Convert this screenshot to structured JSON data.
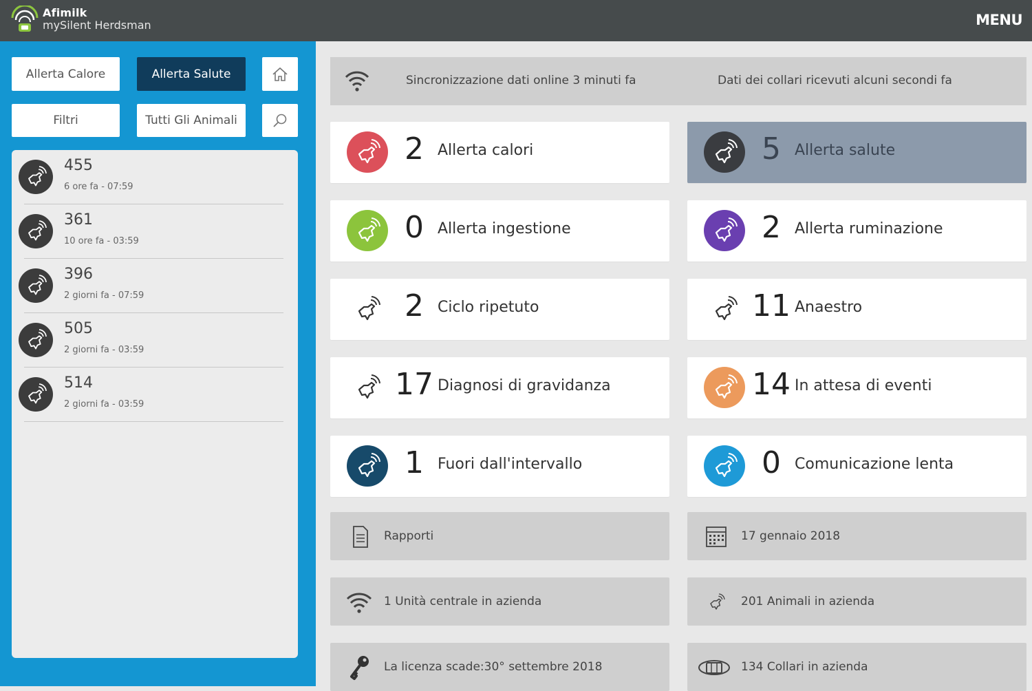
{
  "header": {
    "brand": "Afimilk",
    "subbrand": "mySilent Herdsman",
    "menu_label": "MENU"
  },
  "sidebar": {
    "buttons": {
      "heat_alert": "Allerta Calore",
      "health_alert": "Allerta Salute",
      "filters": "Filtri",
      "all_animals": "Tutti Gli Animali"
    },
    "animals": [
      {
        "id": "455",
        "time": "6 ore fa - 07:59"
      },
      {
        "id": "361",
        "time": "10 ore fa - 03:59"
      },
      {
        "id": "396",
        "time": "2 giorni fa - 07:59"
      },
      {
        "id": "505",
        "time": "2 giorni fa - 03:59"
      },
      {
        "id": "514",
        "time": "2 giorni fa - 03:59"
      }
    ]
  },
  "sync": {
    "online": "Sincronizzazione dati online 3 minuti fa",
    "collars": "Dati dei collari ricevuti alcuni secondi fa"
  },
  "cards": [
    {
      "count": "2",
      "label": "Allerta calori",
      "icon_color": "#dc505a",
      "icon": "cow-alert-icon"
    },
    {
      "count": "5",
      "label": "Allerta salute",
      "icon_color": "#3a3c40",
      "icon": "cow-alert-icon",
      "highlighted": true
    },
    {
      "count": "0",
      "label": "Allerta ingestione",
      "icon_color": "#8cc43c",
      "icon": "cow-alert-icon"
    },
    {
      "count": "2",
      "label": "Allerta ruminazione",
      "icon_color": "#6a3fb0",
      "icon": "cow-alert-icon"
    },
    {
      "count": "2",
      "label": "Ciclo ripetuto",
      "icon_color": null,
      "icon": "cow-outline-icon"
    },
    {
      "count": "11",
      "label": "Anaestro",
      "icon_color": null,
      "icon": "cow-outline-icon"
    },
    {
      "count": "17",
      "label": "Diagnosi di gravidanza",
      "icon_color": null,
      "icon": "cow-outline-icon"
    },
    {
      "count": "14",
      "label": "In attesa di eventi",
      "icon_color": "#ec9a5c",
      "icon": "cow-alert-icon"
    },
    {
      "count": "1",
      "label": "Fuori dall'intervallo",
      "icon_color": "#174a6a",
      "icon": "cow-alert-icon"
    },
    {
      "count": "0",
      "label": "Comunicazione lenta",
      "icon_color": "#1e9ad7",
      "icon": "cow-alert-icon"
    }
  ],
  "info": [
    {
      "label": "Rapporti",
      "icon": "document-icon"
    },
    {
      "label": "17 gennaio 2018",
      "icon": "calendar-icon"
    },
    {
      "label": "1 Unità centrale in azienda",
      "icon": "wifi-icon"
    },
    {
      "label": "201 Animali in azienda",
      "icon": "cow-outline-icon"
    },
    {
      "label": "La licenza scade:30° settembre 2018",
      "icon": "key-icon"
    },
    {
      "label": "134 Collari in azienda",
      "icon": "collar-icon"
    }
  ],
  "colors": {
    "topbar": "#464b4c",
    "sidebar": "#1496d2",
    "active_button": "#103c5b",
    "highlight_card": "#8c9aab"
  }
}
